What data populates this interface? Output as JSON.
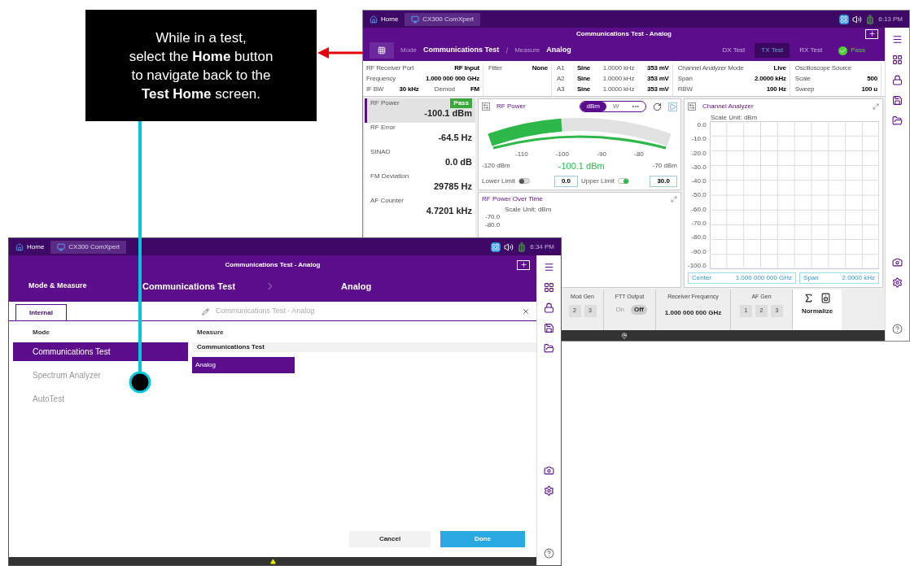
{
  "callout": {
    "text": "While in a test,\nselect the **Home** button\nto navigate back to the\n**Test Home** screen."
  },
  "test_screen": {
    "status": {
      "home": "Home",
      "app": "CX300 ComXpert",
      "time": "6:13 PM"
    },
    "title": "Communications Test - Analog",
    "mode_bar": {
      "mode_label": "Mode",
      "mode": "Communications Test",
      "separator": "/",
      "measure_label": "Measure",
      "measure": "Analog",
      "status": "Pass"
    },
    "test_tabs": [
      {
        "label": "DX Test",
        "selected": false
      },
      {
        "label": "TX Test",
        "selected": true
      },
      {
        "label": "RX Test",
        "selected": false
      }
    ],
    "info_groups": [
      {
        "rows": [
          [
            "RF Receiver Port",
            "RF Input"
          ],
          [
            "Frequency",
            "1.000 000 000 GHz"
          ],
          [
            "IF BW",
            "30 kHz",
            "Demod",
            "FM"
          ]
        ]
      },
      {
        "rows": [
          [
            "Filter",
            "None"
          ]
        ]
      },
      {
        "rows": [
          [
            "A1",
            "Sine",
            "1.0000 kHz",
            "353 mV"
          ],
          [
            "A2",
            "Sine",
            "1.0000 kHz",
            "353 mV"
          ],
          [
            "A3",
            "Sine",
            "1.0000 kHz",
            "353 mV"
          ]
        ]
      },
      {
        "rows": [
          [
            "Channel Analyzer Mode",
            "Live"
          ],
          [
            "Span",
            "2.0000 kHz"
          ],
          [
            "RBW",
            "100 Hz"
          ]
        ]
      },
      {
        "rows": [
          [
            "Oscilloscope Source"
          ],
          [
            "Scale",
            "500"
          ],
          [
            "Sweep",
            "100 u"
          ]
        ]
      }
    ],
    "results": [
      {
        "label": "RF Power",
        "value": "-100.1 dBm",
        "selected": true,
        "badge": "Pass"
      },
      {
        "label": "RF Error",
        "value": "-64.5 Hz",
        "selected": false
      },
      {
        "label": "SINAD",
        "value": "0.0 dB",
        "selected": false
      },
      {
        "label": "FM Deviation",
        "value": "29785 Hz",
        "selected": false
      },
      {
        "label": "AF Counter",
        "value": "4.7201 kHz",
        "selected": false
      }
    ],
    "rf_power": {
      "title": "RF Power",
      "units": [
        {
          "label": "dBm",
          "selected": true
        },
        {
          "label": "W",
          "selected": false
        },
        {
          "label": "•••",
          "selected": false
        }
      ],
      "gauge": {
        "level": 0.4,
        "scale": [
          "-110",
          "-100",
          "-90",
          "-80"
        ],
        "min": "-120 dBm",
        "max": "-70 dBm",
        "reading": "-100.1 dBm"
      },
      "limits": [
        {
          "label": "Lower Limit",
          "on": false,
          "value": "0.0"
        },
        {
          "label": "Upper Limit",
          "on": true,
          "value": "30.0"
        }
      ]
    },
    "over_time": {
      "title": "RF Power Over Time",
      "scale_unit": "Scale Unit: dBm",
      "y_labels": [
        "-70.0",
        "-80.0"
      ]
    },
    "channel": {
      "title": "Channel Analyzer",
      "scale_unit": "Scale Unit: dBm",
      "y_labels": [
        "0.0",
        "-10.0",
        "-20.0",
        "-30.0",
        "-40.0",
        "-50.0",
        "-60.0",
        "-70.0",
        "-80.0",
        "-90.0",
        "-100.0"
      ],
      "center_label": "Center",
      "center": "1.000 000 000 GHz",
      "span_label": "Span",
      "span": "2.0000 kHz"
    },
    "mod_gen": {
      "title": "Mod Gen",
      "buttons": [
        "2",
        "3"
      ]
    },
    "ftt": {
      "title": "FTT Output",
      "options": [
        {
          "label": "On",
          "selected": false
        },
        {
          "label": "Off",
          "selected": true
        }
      ]
    },
    "receiver": {
      "title": "Receiver Frequency",
      "value": "1.000 000 000 GHz"
    },
    "af_gen": {
      "title": "AF Gen",
      "buttons": [
        "1",
        "2",
        "3"
      ]
    },
    "normalize": "Normalize"
  },
  "home_screen": {
    "status": {
      "home": "Home",
      "app": "CX300 ComXpert",
      "time": "6:34 PM"
    },
    "title": "Communications Test - Analog",
    "breadcrumb": {
      "heading": "Mode & Measure",
      "mode": "Communications Test",
      "measure": "Analog"
    },
    "tabs": [
      {
        "label": "Internal",
        "selected": true
      }
    ],
    "search": {
      "placeholder": "Communications Test - Analog"
    },
    "mode_header": "Mode",
    "modes": [
      {
        "label": "Communications Test",
        "selected": true
      },
      {
        "label": "Spectrum Analyzer",
        "selected": false
      },
      {
        "label": "AutoTest",
        "selected": false
      }
    ],
    "measure_header": "Measure",
    "measure_groups": [
      {
        "title": "Communications Test",
        "items": [
          {
            "label": "Analog",
            "selected": true
          }
        ]
      }
    ],
    "buttons": {
      "cancel": "Cancel",
      "done": "Done"
    }
  }
}
